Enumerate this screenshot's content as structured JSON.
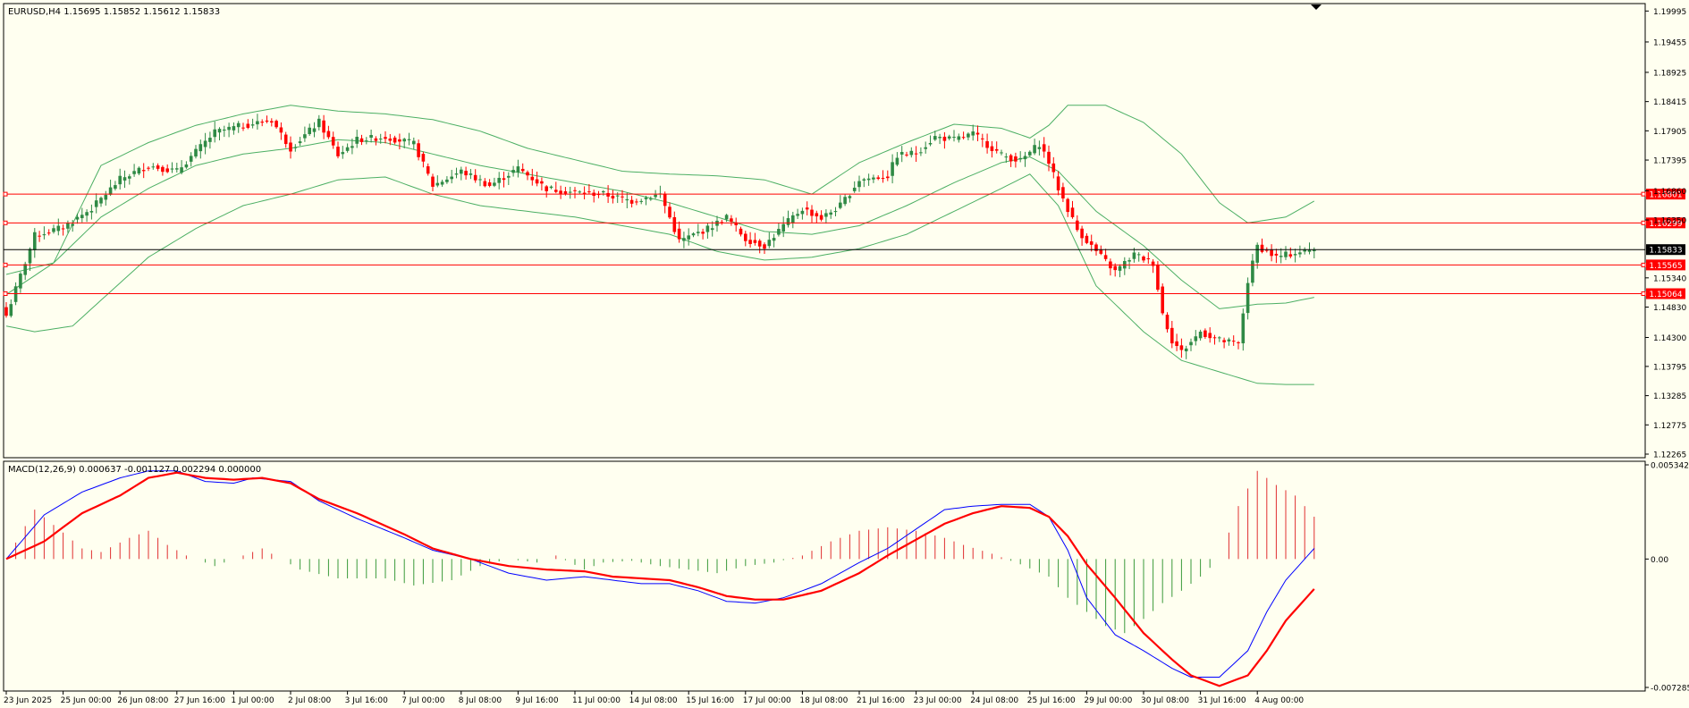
{
  "colors": {
    "background": "#fffff0",
    "frame": "#000000",
    "bull": "#2f8a45",
    "bear": "#ff0000",
    "band": "#4caf64",
    "level": "#ff0000",
    "price_line": "#000000",
    "macd_line": "#0000ff",
    "signal_line": "#ff0000",
    "hist_pos": "#e03030",
    "hist_neg": "#3a9a3a"
  },
  "chart_data": [
    {
      "type": "candlestick",
      "title": "EURUSD,H4  1.15695 1.15852 1.15612 1.15833",
      "ylim": [
        1.12265,
        1.2
      ],
      "yticks": [
        "1.19995",
        "1.19455",
        "1.18925",
        "1.18415",
        "1.17905",
        "1.17395",
        "1.16860",
        "1.16350",
        "1.15833",
        "1.15340",
        "1.14830",
        "1.14300",
        "1.13795",
        "1.13285",
        "1.12775",
        "1.12265"
      ],
      "xticks": [
        {
          "label": "23 Jun 2025",
          "i": 0
        },
        {
          "label": "25 Jun 00:00",
          "i": 12
        },
        {
          "label": "26 Jun 08:00",
          "i": 24
        },
        {
          "label": "27 Jun 16:00",
          "i": 36
        },
        {
          "label": "1 Jul 00:00",
          "i": 48
        },
        {
          "label": "2 Jul 08:00",
          "i": 60
        },
        {
          "label": "3 Jul 16:00",
          "i": 72
        },
        {
          "label": "7 Jul 00:00",
          "i": 84
        },
        {
          "label": "8 Jul 08:00",
          "i": 96
        },
        {
          "label": "9 Jul 16:00",
          "i": 108
        },
        {
          "label": "11 Jul 00:00",
          "i": 120
        },
        {
          "label": "14 Jul 08:00",
          "i": 132
        },
        {
          "label": "15 Jul 16:00",
          "i": 144
        },
        {
          "label": "17 Jul 00:00",
          "i": 156
        },
        {
          "label": "18 Jul 08:00",
          "i": 168
        },
        {
          "label": "21 Jul 16:00",
          "i": 180
        },
        {
          "label": "23 Jul 00:00",
          "i": 192
        },
        {
          "label": "24 Jul 08:00",
          "i": 204
        },
        {
          "label": "25 Jul 16:00",
          "i": 216
        },
        {
          "label": "29 Jul 00:00",
          "i": 228
        },
        {
          "label": "30 Jul 08:00",
          "i": 240
        },
        {
          "label": "31 Jul 16:00",
          "i": 252
        },
        {
          "label": "4 Aug 00:00",
          "i": 264
        }
      ],
      "close_anchors": [
        [
          0,
          1.1468
        ],
        [
          6,
          1.1608
        ],
        [
          12,
          1.1622
        ],
        [
          18,
          1.1655
        ],
        [
          24,
          1.1706
        ],
        [
          30,
          1.173
        ],
        [
          36,
          1.172
        ],
        [
          44,
          1.1788
        ],
        [
          50,
          1.18
        ],
        [
          56,
          1.1809
        ],
        [
          60,
          1.176
        ],
        [
          66,
          1.1806
        ],
        [
          70,
          1.1748
        ],
        [
          74,
          1.1775
        ],
        [
          80,
          1.178
        ],
        [
          86,
          1.1768
        ],
        [
          90,
          1.1695
        ],
        [
          96,
          1.172
        ],
        [
          102,
          1.1695
        ],
        [
          108,
          1.1725
        ],
        [
          114,
          1.169
        ],
        [
          120,
          1.1683
        ],
        [
          126,
          1.168
        ],
        [
          132,
          1.1668
        ],
        [
          138,
          1.168
        ],
        [
          142,
          1.1598
        ],
        [
          148,
          1.162
        ],
        [
          152,
          1.164
        ],
        [
          156,
          1.1602
        ],
        [
          160,
          1.159
        ],
        [
          164,
          1.1625
        ],
        [
          168,
          1.1655
        ],
        [
          172,
          1.1638
        ],
        [
          176,
          1.166
        ],
        [
          180,
          1.1705
        ],
        [
          186,
          1.1712
        ],
        [
          188,
          1.1748
        ],
        [
          192,
          1.1752
        ],
        [
          196,
          1.178
        ],
        [
          200,
          1.1775
        ],
        [
          204,
          1.1785
        ],
        [
          210,
          1.1748
        ],
        [
          214,
          1.1738
        ],
        [
          218,
          1.1768
        ],
        [
          220,
          1.1736
        ],
        [
          222,
          1.169
        ],
        [
          226,
          1.1618
        ],
        [
          230,
          1.158
        ],
        [
          234,
          1.1545
        ],
        [
          238,
          1.1575
        ],
        [
          242,
          1.156
        ],
        [
          244,
          1.1472
        ],
        [
          246,
          1.1425
        ],
        [
          248,
          1.1405
        ],
        [
          252,
          1.144
        ],
        [
          256,
          1.1425
        ],
        [
          260,
          1.1418
        ],
        [
          262,
          1.1528
        ],
        [
          264,
          1.159
        ],
        [
          268,
          1.157
        ],
        [
          272,
          1.1578
        ],
        [
          276,
          1.1583
        ]
      ],
      "candles_count": 277,
      "last_price": 1.15833,
      "bands": {
        "upper": [
          [
            0,
            1.154
          ],
          [
            10,
            1.156
          ],
          [
            20,
            1.173
          ],
          [
            30,
            1.177
          ],
          [
            40,
            1.18
          ],
          [
            50,
            1.182
          ],
          [
            60,
            1.1835
          ],
          [
            70,
            1.1825
          ],
          [
            80,
            1.182
          ],
          [
            90,
            1.181
          ],
          [
            100,
            1.179
          ],
          [
            110,
            1.176
          ],
          [
            120,
            1.174
          ],
          [
            130,
            1.172
          ],
          [
            140,
            1.1715
          ],
          [
            150,
            1.1712
          ],
          [
            160,
            1.1705
          ],
          [
            170,
            1.168
          ],
          [
            180,
            1.1735
          ],
          [
            190,
            1.177
          ],
          [
            200,
            1.1802
          ],
          [
            210,
            1.1795
          ],
          [
            216,
            1.1778
          ],
          [
            220,
            1.18
          ],
          [
            224,
            1.1835
          ],
          [
            232,
            1.1835
          ],
          [
            240,
            1.1805
          ],
          [
            248,
            1.175
          ],
          [
            256,
            1.1665
          ],
          [
            262,
            1.163
          ],
          [
            270,
            1.164
          ],
          [
            276,
            1.1668
          ]
        ],
        "mid": [
          [
            0,
            1.1505
          ],
          [
            10,
            1.156
          ],
          [
            20,
            1.164
          ],
          [
            30,
            1.169
          ],
          [
            40,
            1.173
          ],
          [
            50,
            1.175
          ],
          [
            60,
            1.176
          ],
          [
            70,
            1.1775
          ],
          [
            80,
            1.177
          ],
          [
            90,
            1.175
          ],
          [
            100,
            1.173
          ],
          [
            110,
            1.1715
          ],
          [
            120,
            1.17
          ],
          [
            130,
            1.1685
          ],
          [
            140,
            1.1665
          ],
          [
            150,
            1.164
          ],
          [
            160,
            1.1615
          ],
          [
            170,
            1.161
          ],
          [
            180,
            1.1625
          ],
          [
            190,
            1.166
          ],
          [
            200,
            1.17
          ],
          [
            210,
            1.1735
          ],
          [
            216,
            1.1745
          ],
          [
            222,
            1.172
          ],
          [
            230,
            1.165
          ],
          [
            240,
            1.159
          ],
          [
            248,
            1.153
          ],
          [
            256,
            1.148
          ],
          [
            264,
            1.1488
          ],
          [
            270,
            1.149
          ],
          [
            276,
            1.15
          ]
        ],
        "lower": [
          [
            0,
            1.145
          ],
          [
            6,
            1.144
          ],
          [
            14,
            1.145
          ],
          [
            20,
            1.1495
          ],
          [
            30,
            1.157
          ],
          [
            40,
            1.162
          ],
          [
            50,
            1.166
          ],
          [
            60,
            1.168
          ],
          [
            70,
            1.1705
          ],
          [
            80,
            1.171
          ],
          [
            90,
            1.168
          ],
          [
            100,
            1.166
          ],
          [
            110,
            1.165
          ],
          [
            120,
            1.164
          ],
          [
            130,
            1.1625
          ],
          [
            140,
            1.161
          ],
          [
            150,
            1.158
          ],
          [
            160,
            1.1565
          ],
          [
            170,
            1.157
          ],
          [
            180,
            1.1585
          ],
          [
            190,
            1.161
          ],
          [
            200,
            1.165
          ],
          [
            210,
            1.169
          ],
          [
            216,
            1.1715
          ],
          [
            222,
            1.166
          ],
          [
            230,
            1.152
          ],
          [
            240,
            1.144
          ],
          [
            248,
            1.139
          ],
          [
            256,
            1.137
          ],
          [
            264,
            1.135
          ],
          [
            270,
            1.1348
          ],
          [
            276,
            1.1348
          ]
        ]
      },
      "levels": [
        "1.16801",
        "1.16299",
        "1.15565",
        "1.15064"
      ],
      "current_label": "1.15833"
    },
    {
      "type": "macd",
      "title": "MACD(12,26,9) 0.000637 -0.001127 0.002294 0.000000",
      "ylim": [
        -0.007285,
        0.005342
      ],
      "yticks": [
        "0.005342",
        "0.00",
        "-0.007285"
      ],
      "macd": [
        [
          0,
          -0.0
        ],
        [
          8,
          0.0025
        ],
        [
          16,
          0.0038
        ],
        [
          24,
          0.0046
        ],
        [
          30,
          0.005
        ],
        [
          36,
          0.005
        ],
        [
          42,
          0.0044
        ],
        [
          48,
          0.0043
        ],
        [
          52,
          0.0046
        ],
        [
          60,
          0.0044
        ],
        [
          66,
          0.0033
        ],
        [
          74,
          0.0023
        ],
        [
          84,
          0.0012
        ],
        [
          90,
          0.0005
        ],
        [
          98,
          0.0
        ],
        [
          106,
          -0.0008
        ],
        [
          114,
          -0.0012
        ],
        [
          122,
          -0.001
        ],
        [
          128,
          -0.0012
        ],
        [
          134,
          -0.0014
        ],
        [
          140,
          -0.0014
        ],
        [
          146,
          -0.0018
        ],
        [
          152,
          -0.0024
        ],
        [
          158,
          -0.0025
        ],
        [
          164,
          -0.0022
        ],
        [
          172,
          -0.0014
        ],
        [
          180,
          -0.0002
        ],
        [
          186,
          0.0006
        ],
        [
          192,
          0.0017
        ],
        [
          198,
          0.0028
        ],
        [
          204,
          0.003
        ],
        [
          210,
          0.0031
        ],
        [
          216,
          0.0031
        ],
        [
          220,
          0.0024
        ],
        [
          224,
          0.0005
        ],
        [
          228,
          -0.0022
        ],
        [
          234,
          -0.0043
        ],
        [
          240,
          -0.0052
        ],
        [
          246,
          -0.0062
        ],
        [
          250,
          -0.0067
        ],
        [
          256,
          -0.0067
        ],
        [
          262,
          -0.0052
        ],
        [
          266,
          -0.003
        ],
        [
          270,
          -0.0012
        ],
        [
          276,
          0.0006
        ]
      ],
      "signal": [
        [
          0,
          0.0
        ],
        [
          8,
          0.001
        ],
        [
          16,
          0.0026
        ],
        [
          24,
          0.0036
        ],
        [
          30,
          0.0046
        ],
        [
          36,
          0.0049
        ],
        [
          42,
          0.0046
        ],
        [
          48,
          0.0045
        ],
        [
          54,
          0.0046
        ],
        [
          60,
          0.0043
        ],
        [
          66,
          0.0034
        ],
        [
          74,
          0.0026
        ],
        [
          84,
          0.0014
        ],
        [
          90,
          0.0006
        ],
        [
          98,
          0.0
        ],
        [
          106,
          -0.0004
        ],
        [
          114,
          -0.0006
        ],
        [
          122,
          -0.0007
        ],
        [
          128,
          -0.001
        ],
        [
          134,
          -0.0011
        ],
        [
          140,
          -0.0012
        ],
        [
          146,
          -0.0016
        ],
        [
          152,
          -0.0021
        ],
        [
          158,
          -0.0023
        ],
        [
          164,
          -0.0023
        ],
        [
          172,
          -0.0018
        ],
        [
          180,
          -0.0008
        ],
        [
          186,
          0.0002
        ],
        [
          192,
          0.0011
        ],
        [
          198,
          0.002
        ],
        [
          204,
          0.0026
        ],
        [
          210,
          0.003
        ],
        [
          216,
          0.0029
        ],
        [
          220,
          0.0024
        ],
        [
          224,
          0.0013
        ],
        [
          228,
          -0.0003
        ],
        [
          234,
          -0.0022
        ],
        [
          240,
          -0.0042
        ],
        [
          246,
          -0.0057
        ],
        [
          250,
          -0.0066
        ],
        [
          256,
          -0.0072
        ],
        [
          262,
          -0.0066
        ],
        [
          266,
          -0.0052
        ],
        [
          270,
          -0.0035
        ],
        [
          276,
          -0.0017
        ]
      ],
      "hist": [
        [
          0,
          0.0
        ],
        [
          6,
          0.0028
        ],
        [
          12,
          0.0015
        ],
        [
          16,
          0.0006
        ],
        [
          20,
          0.0004
        ],
        [
          26,
          0.0012
        ],
        [
          30,
          0.0016
        ],
        [
          34,
          0.0008
        ],
        [
          38,
          0.0002
        ],
        [
          44,
          -0.0004
        ],
        [
          48,
          0.0
        ],
        [
          54,
          0.0006
        ],
        [
          58,
          0.0
        ],
        [
          62,
          -0.0006
        ],
        [
          70,
          -0.0011
        ],
        [
          80,
          -0.0011
        ],
        [
          86,
          -0.0015
        ],
        [
          94,
          -0.0012
        ],
        [
          100,
          -0.0004
        ],
        [
          106,
          0.0
        ],
        [
          112,
          -0.0002
        ],
        [
          116,
          0.0002
        ],
        [
          122,
          -0.0006
        ],
        [
          126,
          -0.0002
        ],
        [
          132,
          -0.0001
        ],
        [
          138,
          -0.0004
        ],
        [
          144,
          -0.0006
        ],
        [
          150,
          -0.0008
        ],
        [
          156,
          -0.0004
        ],
        [
          162,
          -0.0002
        ],
        [
          168,
          0.0002
        ],
        [
          174,
          0.001
        ],
        [
          180,
          0.0016
        ],
        [
          186,
          0.0018
        ],
        [
          192,
          0.0016
        ],
        [
          198,
          0.0012
        ],
        [
          202,
          0.0008
        ],
        [
          208,
          0.0003
        ],
        [
          214,
          -0.0003
        ],
        [
          220,
          -0.001
        ],
        [
          224,
          -0.0022
        ],
        [
          228,
          -0.003
        ],
        [
          232,
          -0.0038
        ],
        [
          236,
          -0.0042
        ],
        [
          240,
          -0.0034
        ],
        [
          244,
          -0.0025
        ],
        [
          248,
          -0.0018
        ],
        [
          252,
          -0.001
        ],
        [
          256,
          0.0
        ],
        [
          260,
          0.003
        ],
        [
          264,
          0.005
        ],
        [
          268,
          0.0042
        ],
        [
          272,
          0.0036
        ],
        [
          276,
          0.0024
        ]
      ]
    }
  ]
}
